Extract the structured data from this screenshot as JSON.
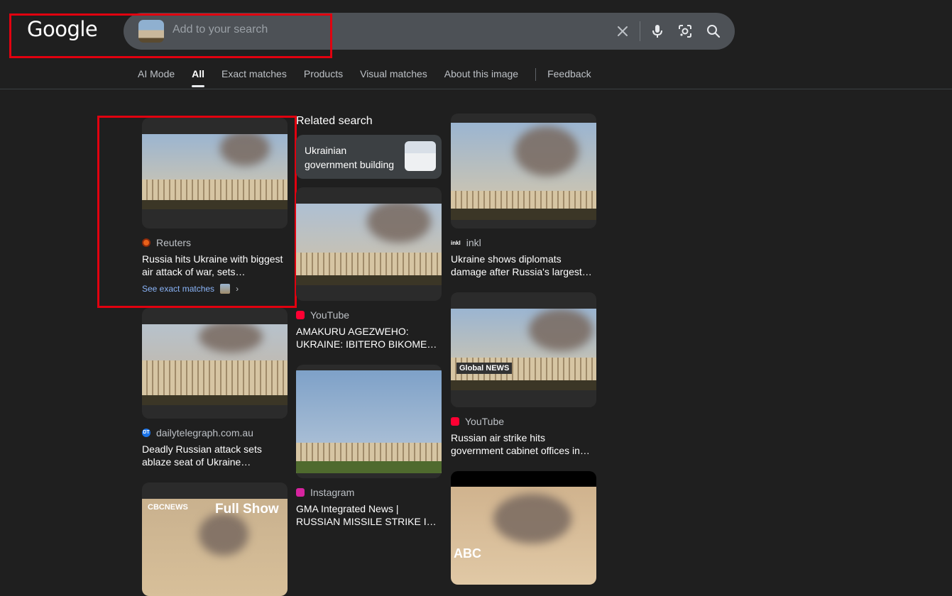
{
  "header": {
    "logo": "Google",
    "search": {
      "placeholder": "Add to your search"
    },
    "icons": [
      "clear-icon",
      "mic-icon",
      "lens-icon",
      "search-icon"
    ]
  },
  "tabs": [
    {
      "label": "AI Mode"
    },
    {
      "label": "All",
      "active": true
    },
    {
      "label": "Exact matches"
    },
    {
      "label": "Products"
    },
    {
      "label": "Visual matches"
    },
    {
      "label": "About this image"
    },
    {
      "label": "Feedback"
    }
  ],
  "col1": [
    {
      "source": "Reuters",
      "title": "Russia hits Ukraine with biggest air attack of war, sets…",
      "see_exact": "See exact matches",
      "fav_color": "#e8611a"
    },
    {
      "source": "dailytelegraph.com.au",
      "title": "Deadly Russian attack sets ablaze seat of Ukraine…",
      "fav_color": "#1a73e8",
      "fav_text": "DT"
    },
    {
      "overlay_brand": "CBCNEWS",
      "overlay_show": "Full Show"
    }
  ],
  "col2": {
    "related_label": "Related search",
    "related_chip": "Ukrainian government building",
    "results": [
      {
        "source": "YouTube",
        "title": "AMAKURU AGEZWEHO: UKRAINE: IBITERO BIKOME…",
        "fav_color": "#ff0033"
      },
      {
        "source": "Instagram",
        "title": "GMA Integrated News | RUSSIAN MISSILE STRIKE I…",
        "fav_color": "#d6249f"
      }
    ]
  },
  "col3": [
    {
      "source": "inkl",
      "title": "Ukraine shows diplomats damage after Russia's largest…",
      "fav_color": "#ffffff",
      "fav_text": "inkl"
    },
    {
      "source": "YouTube",
      "title": "Russian air strike hits government cabinet offices in…",
      "fav_color": "#ff0033",
      "overlay": "Global NEWS"
    },
    {
      "overlay": "ABC"
    }
  ],
  "colors": {
    "background": "#1f1f1f",
    "accent_link": "#8ab4f8",
    "annotation_red": "#e1000f"
  }
}
